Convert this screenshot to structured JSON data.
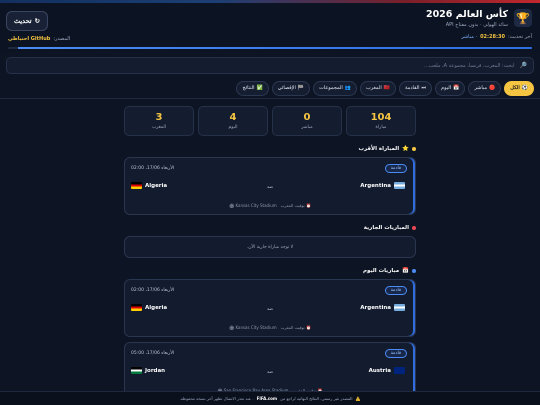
{
  "header": {
    "title": "كأس العالم 2026",
    "subtitle": "سائد الهولي · بدون مفتاح API",
    "updated_label": "آخر تحديث:",
    "updated_time": "02:28:30",
    "updated_status": "· مباشر",
    "refresh_label": "تحديث",
    "fallback_label": "المصدر:",
    "fallback_source": "GitHub احتياطي",
    "progress": 0.98
  },
  "search": {
    "placeholder": "ابحث: المغرب، فرنسا، مجموعة A، ملعب..."
  },
  "nav": [
    {
      "icon": "⚽",
      "label": "الكل",
      "active": true
    },
    {
      "icon": "🔴",
      "label": "مباشر",
      "active": false
    },
    {
      "icon": "📅",
      "label": "اليوم",
      "active": false
    },
    {
      "icon": "⏭",
      "label": "القادمة",
      "active": false
    },
    {
      "icon": "🇲🇦",
      "label": "المغرب",
      "active": false
    },
    {
      "icon": "👥",
      "label": "المجموعات",
      "active": false
    },
    {
      "icon": "🏁",
      "label": "الإقصائي",
      "active": false
    },
    {
      "icon": "✅",
      "label": "النتائج",
      "active": false
    }
  ],
  "stats": [
    {
      "value": "104",
      "label": "مباراة"
    },
    {
      "value": "0",
      "label": "مباشر"
    },
    {
      "value": "4",
      "label": "اليوم"
    },
    {
      "value": "3",
      "label": "المغرب"
    }
  ],
  "sections": {
    "next": {
      "icon": "⭐",
      "title": "المباراة الأقرب",
      "dot": "#f5c542"
    },
    "live": {
      "title": "المباريات الجارية",
      "dot": "#e84855",
      "empty": "لا توجد مباراة جارية الآن."
    },
    "today": {
      "icon": "📅",
      "title": "مباريات اليوم",
      "dot": "#4c8bf5"
    }
  },
  "next_match": {
    "badge": "قادمة",
    "when": "الأربعاء 17/06، 02:00",
    "home": "Argentina",
    "away": "Algeria",
    "vs": "ضد",
    "venue": "Kansas City Stadium 🏟",
    "tz": "⏰ توقيت المغرب"
  },
  "today_matches": [
    {
      "badge": "قادمة",
      "when": "الأربعاء 17/06، 02:00",
      "home": "Argentina",
      "away": "Algeria",
      "vs": "ضد",
      "venue": "Kansas City Stadium 🏟",
      "tz": "⏰ توقيت المغرب"
    },
    {
      "badge": "قادمة",
      "when": "الأربعاء 17/06، 05:00",
      "home": "Austria",
      "away": "Jordan",
      "vs": "ضد",
      "venue": "San Francisco Bay Area Stadium 🏟",
      "tz": "⏰ توقيت المغرب"
    }
  ],
  "footer": {
    "icon": "⚠️",
    "text_before": "المصدر غير رسمي. النتائج النهائية تُراجع من",
    "source": "FIFA.com",
    "text_after": ". عند تعذر الاتصال تظهر آخر نسخة محفوظة."
  },
  "colors": {
    "accent": "#f5c542",
    "brand_blue": "#4c8bf5",
    "live_red": "#e84855"
  }
}
